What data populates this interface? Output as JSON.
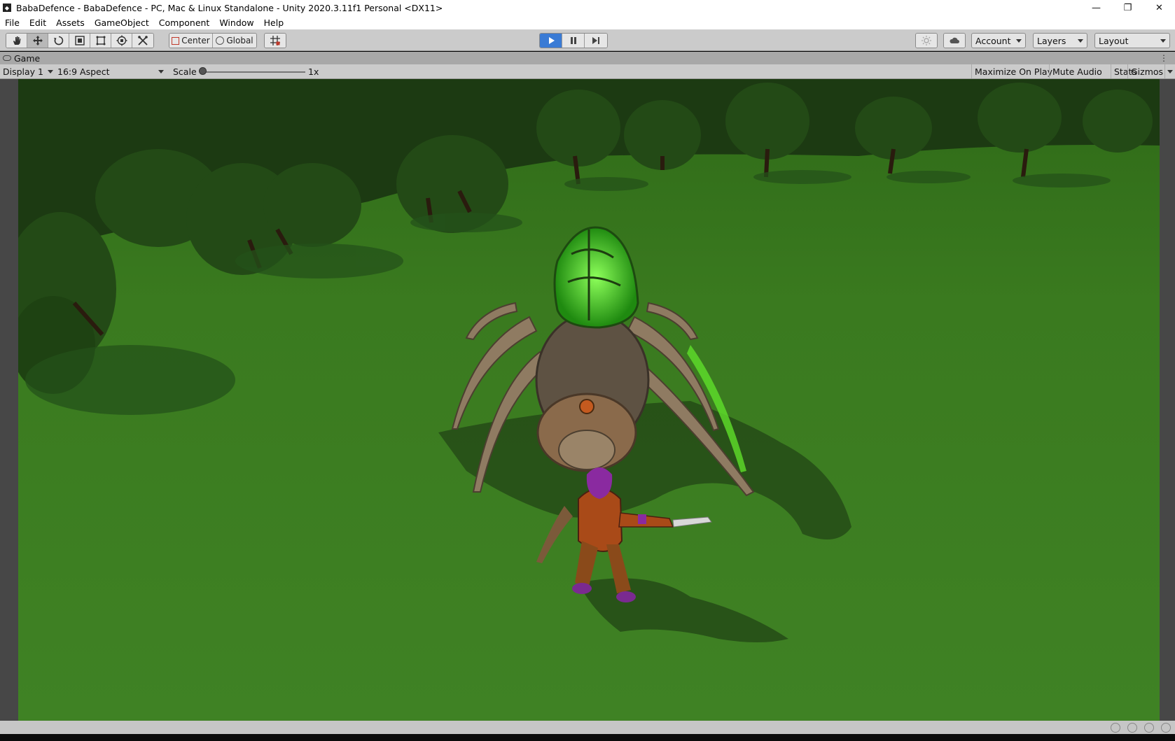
{
  "window": {
    "title": "BabaDefence - BabaDefence - PC, Mac & Linux Standalone - Unity 2020.3.11f1 Personal <DX11>",
    "minimize": "—",
    "restore": "❐",
    "close": "✕"
  },
  "menu": [
    "File",
    "Edit",
    "Assets",
    "GameObject",
    "Component",
    "Window",
    "Help"
  ],
  "toolbar": {
    "tools": [
      "hand-tool",
      "move-tool",
      "rotate-tool",
      "scale-tool",
      "rect-tool",
      "transform-tool",
      "custom-tool"
    ],
    "pivot_mode": "Center",
    "pivot_rotation": "Global",
    "play_state": "playing",
    "account_label": "Account",
    "layers_label": "Layers",
    "layout_label": "Layout",
    "accent_color": "#3a7bd5"
  },
  "game_tab": {
    "label": "Game"
  },
  "game_bar": {
    "display": "Display 1",
    "aspect": "16:9 Aspect",
    "scale_label": "Scale",
    "scale_value": "1x",
    "scale_fraction": 0.0,
    "maximize_on_play": "Maximize On Play",
    "mute_audio": "Mute Audio",
    "stats": "Stats",
    "gizmos": "Gizmos"
  },
  "scene": {
    "ground_color": "#3e7a22",
    "forest_color": "#1f3d14"
  }
}
